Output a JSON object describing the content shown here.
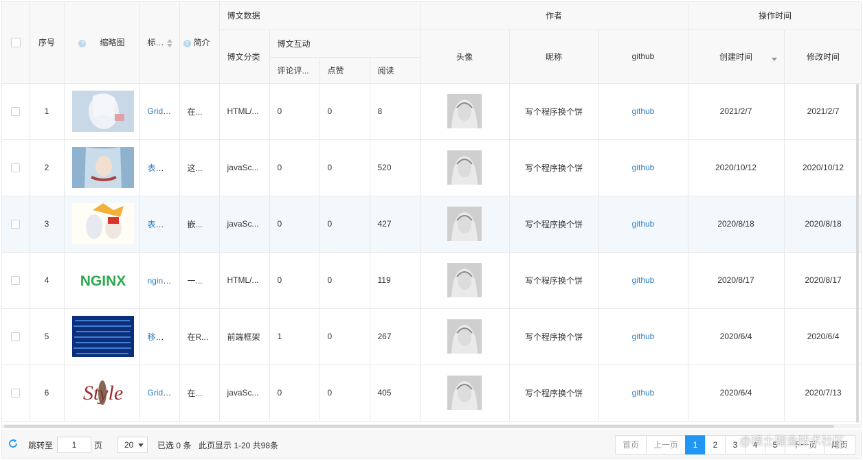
{
  "header": {
    "group_blog": "博文数据",
    "group_author": "作者",
    "group_optime": "操作时间",
    "group_interact": "博文互动",
    "col_index": "序号",
    "col_thumb": "缩略图",
    "col_title": "标题",
    "col_intro": "简介",
    "col_category": "博文分类",
    "col_comments": "评论评...",
    "col_likes": "点赞",
    "col_reads": "阅读",
    "col_avatar": "头像",
    "col_nickname": "昵称",
    "col_github": "github",
    "col_created": "创建时间",
    "col_modified": "修改时间",
    "help_icon": "?"
  },
  "rows": [
    {
      "index": "1",
      "title": "GridManager",
      "intro": "在...",
      "category": "HTML/...",
      "comments": "0",
      "likes": "0",
      "reads": "8",
      "nickname": "写个程序换个饼",
      "github": "github",
      "created": "2021/2/7",
      "modified": "2021/2/7"
    },
    {
      "index": "2",
      "title": "表格组件",
      "intro": "这...",
      "category": "javaSc...",
      "comments": "0",
      "likes": "0",
      "reads": "520",
      "nickname": "写个程序换个饼",
      "github": "github",
      "created": "2020/10/12",
      "modified": "2020/10/12"
    },
    {
      "index": "3",
      "title": "表格组件",
      "intro": "嵌...",
      "category": "javaSc...",
      "comments": "0",
      "likes": "0",
      "reads": "427",
      "nickname": "写个程序换个饼",
      "github": "github",
      "created": "2020/8/18",
      "modified": "2020/8/18"
    },
    {
      "index": "4",
      "title": "nginx安装",
      "intro": "一...",
      "category": "HTML/...",
      "comments": "0",
      "likes": "0",
      "reads": "119",
      "nickname": "写个程序换个饼",
      "github": "github",
      "created": "2020/8/17",
      "modified": "2020/8/17"
    },
    {
      "index": "5",
      "title": "移除react",
      "intro": "在R...",
      "category": "前端框架",
      "comments": "1",
      "likes": "0",
      "reads": "267",
      "nickname": "写个程序换个饼",
      "github": "github",
      "created": "2020/6/4",
      "modified": "2020/6/4"
    },
    {
      "index": "6",
      "title": "GridManager",
      "intro": "在...",
      "category": "javaSc...",
      "comments": "0",
      "likes": "0",
      "reads": "405",
      "nickname": "写个程序换个饼",
      "github": "github",
      "created": "2020/6/4",
      "modified": "2020/7/13"
    }
  ],
  "thumb_text": {
    "nginx": "NGINX",
    "style": "Style"
  },
  "footer": {
    "jump_label": "跳转至",
    "jump_value": "1",
    "page_unit": "页",
    "page_size": "20",
    "selected_text": "已选 0 条",
    "range_text": "此页显示 1-20 共98条"
  },
  "pager": {
    "first": "首页",
    "prev": "上一页",
    "pages": [
      "1",
      "2",
      "3",
      "4",
      "5"
    ],
    "next": "下一页",
    "last": "尾页"
  },
  "watermark": "@稀土掘金技术社区",
  "colors": {
    "accent": "#2196f3",
    "link": "#2d7cc4",
    "header_bg": "#f8f8f8",
    "hover_row": "#f2f8fb"
  }
}
